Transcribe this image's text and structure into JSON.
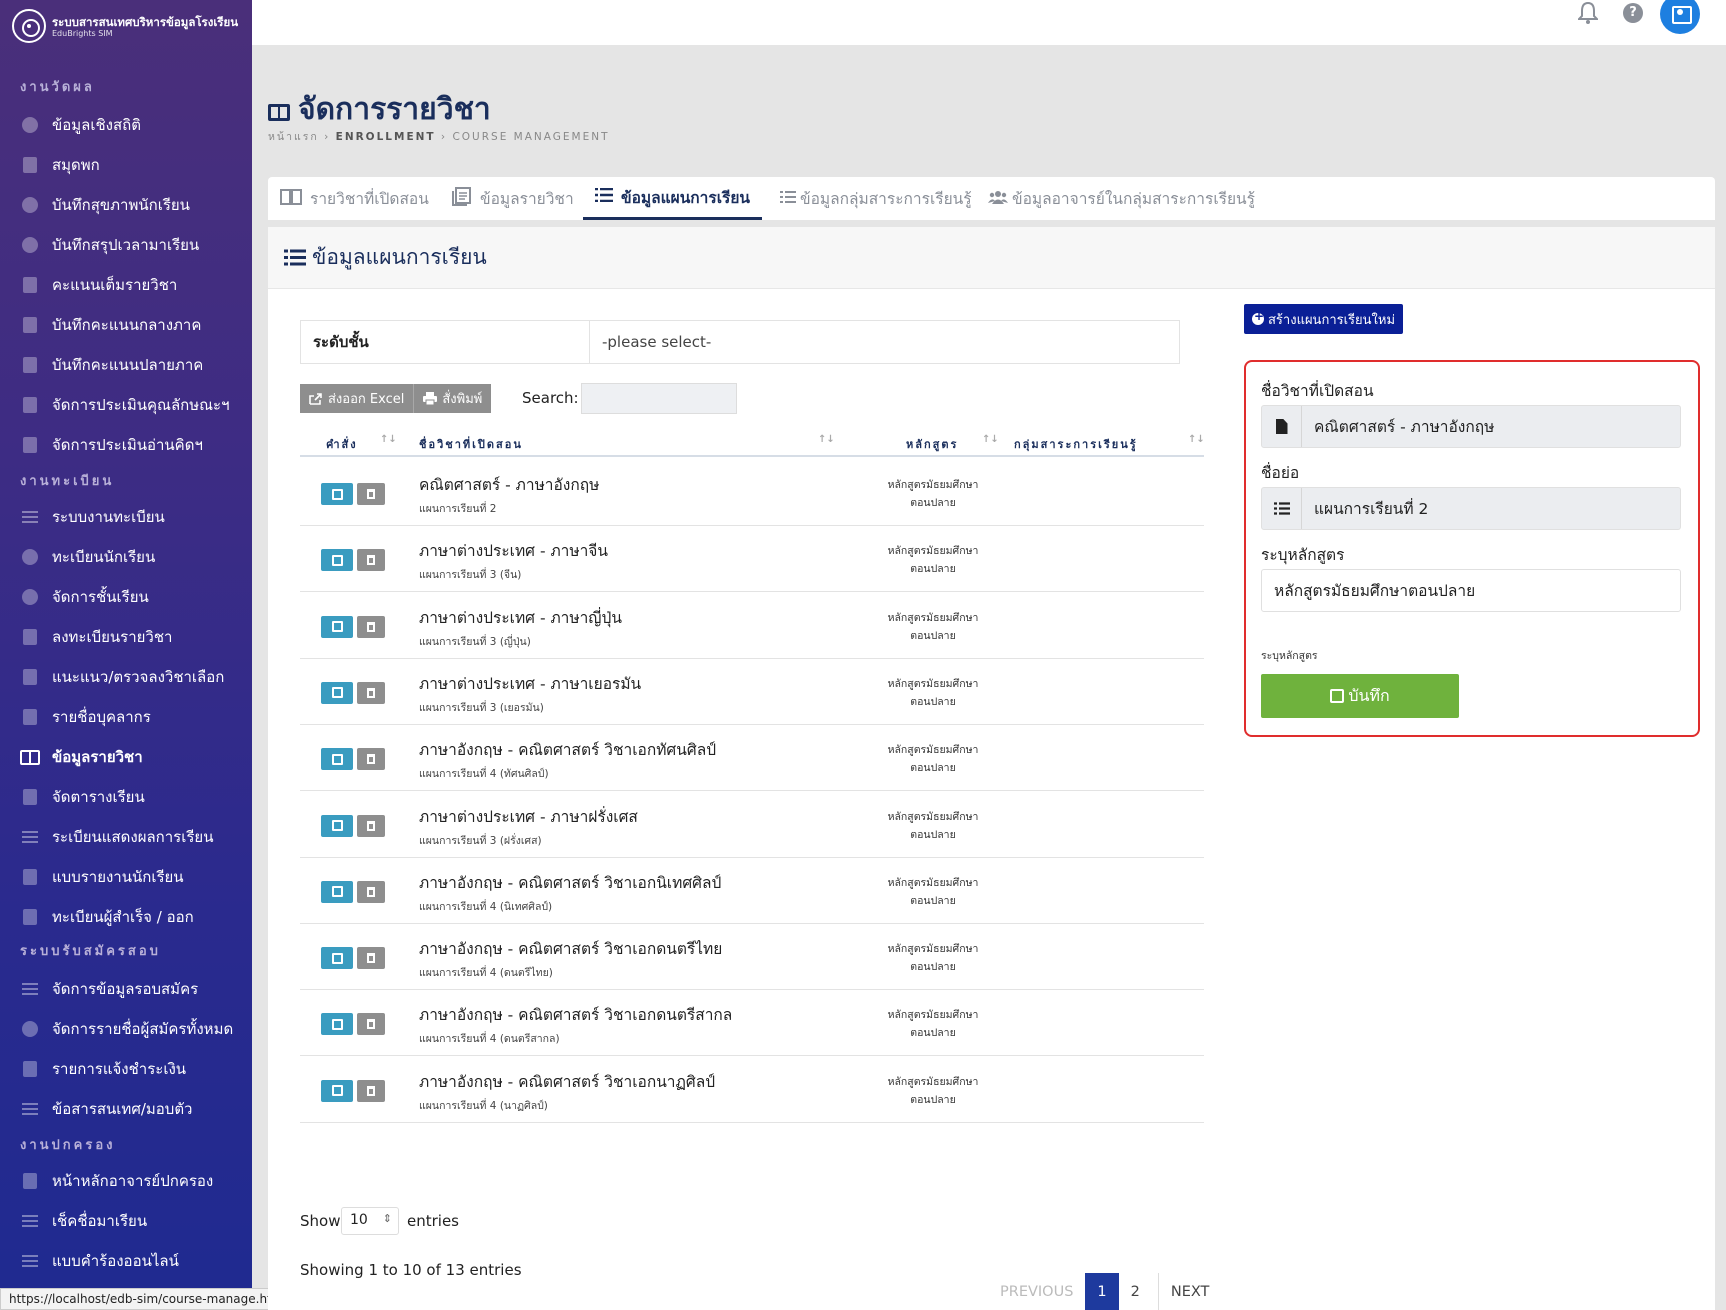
{
  "brand": {
    "title": "ระบบสารสนเทศบริหารข้อมูลโรงเรียน",
    "subtitle": "EduBrights SIM"
  },
  "sidebar": {
    "sections": [
      {
        "label": "งานวัดผล",
        "items": [
          {
            "label": "ข้อมูลเชิงสถิติ",
            "icon": "chart-pie-icon"
          },
          {
            "label": "สมุดพก",
            "icon": "book-icon"
          },
          {
            "label": "บันทึกสุขภาพนักเรียน",
            "icon": "shield-icon"
          },
          {
            "label": "บันทึกสรุปเวลามาเรียน",
            "icon": "shield-icon"
          },
          {
            "label": "คะแนนเต็มรายวิชา",
            "icon": "book-icon"
          },
          {
            "label": "บันทึกคะแนนกลางภาค",
            "icon": "book-icon"
          },
          {
            "label": "บันทึกคะแนนปลายภาค",
            "icon": "book-icon"
          },
          {
            "label": "จัดการประเมินคุณลักษณะฯ",
            "icon": "book-icon"
          },
          {
            "label": "จัดการประเมินอ่านคิดฯ",
            "icon": "book-icon"
          }
        ]
      },
      {
        "label": "งานทะเบียน",
        "items": [
          {
            "label": "ระบบงานทะเบียน",
            "icon": "list-icon"
          },
          {
            "label": "ทะเบียนนักเรียน",
            "icon": "smile-icon"
          },
          {
            "label": "จัดการชั้นเรียน",
            "icon": "user-circle-icon"
          },
          {
            "label": "ลงทะเบียนรายวิชา",
            "icon": "checklist-icon"
          },
          {
            "label": "แนะแนว/ตรวจลงวิชาเลือก",
            "icon": "plus-square-icon"
          },
          {
            "label": "รายชื่อบุคลากร",
            "icon": "id-badge-icon"
          },
          {
            "label": "ข้อมูลรายวิชา",
            "icon": "book-open-icon",
            "active": true
          },
          {
            "label": "จัดตารางเรียน",
            "icon": "calendar-icon"
          },
          {
            "label": "ระเบียนแสดงผลการเรียน",
            "icon": "align-icon"
          },
          {
            "label": "แบบรายงานนักเรียน",
            "icon": "print-icon"
          },
          {
            "label": "ทะเบียนผู้สำเร็จ / ออก",
            "icon": "graduation-cap-icon"
          }
        ]
      },
      {
        "label": "ระบบรับสมัครสอบ",
        "items": [
          {
            "label": "จัดการข้อมูลรอบสมัคร",
            "icon": "list-icon"
          },
          {
            "label": "จัดการรายชื่อผู้สมัครทั้งหมด",
            "icon": "user-icon"
          },
          {
            "label": "รายการแจ้งชำระเงิน",
            "icon": "payment-icon"
          },
          {
            "label": "ข้อสารสนเทศ/มอบตัว",
            "icon": "list-icon"
          }
        ]
      },
      {
        "label": "งานปกครอง",
        "items": [
          {
            "label": "หน้าหลักอาจารย์ปกครอง",
            "icon": "dashboard-icon"
          },
          {
            "label": "เช็คชื่อมาเรียน",
            "icon": "check-icon"
          },
          {
            "label": "แบบคำร้องออนไลน์",
            "icon": "form-icon"
          }
        ]
      }
    ]
  },
  "status_url": "https://localhost/edb-sim/course-manage.html#",
  "page": {
    "title": "จัดการรายวิชา",
    "breadcrumb": [
      "หน้าแรก",
      "ENROLLMENT",
      "COURSE MANAGEMENT"
    ]
  },
  "tabs": [
    {
      "label": "รายวิชาที่เปิดสอน",
      "icon": "book-open-icon",
      "active": false
    },
    {
      "label": "ข้อมูลรายวิชา",
      "icon": "clipboard-icon",
      "active": false
    },
    {
      "label": "ข้อมูลแผนการเรียน",
      "icon": "list-icon",
      "active": true
    },
    {
      "label": "ข้อมูลกลุ่มสาระการเรียนรู้",
      "icon": "list-icon",
      "active": false
    },
    {
      "label": "ข้อมูลอาจารย์ในกลุ่มสาระการเรียนรู้",
      "icon": "users-icon",
      "active": false
    }
  ],
  "card": {
    "title": "ข้อมูลแผนการเรียน"
  },
  "filter": {
    "label": "ระดับชั้น",
    "value": "-please select-"
  },
  "toolbar": {
    "excel": "ส่งออก Excel",
    "print": "สั่งพิมพ์",
    "search_label": "Search:"
  },
  "table": {
    "headers": [
      "คำสั่ง",
      "ชื่อวิชาที่เปิดสอน",
      "หลักสูตร",
      "กลุ่มสาระการเรียนรู้"
    ],
    "rows": [
      {
        "name": "คณิตศาสตร์ - ภาษาอังกฤษ",
        "plan": "แผนการเรียนที่ 2",
        "cur1": "หลักสูตรมัธยมศึกษา",
        "cur2": "ตอนปลาย"
      },
      {
        "name": "ภาษาต่างประเทศ - ภาษาจีน",
        "plan": "แผนการเรียนที่ 3 (จีน)",
        "cur1": "หลักสูตรมัธยมศึกษา",
        "cur2": "ตอนปลาย"
      },
      {
        "name": "ภาษาต่างประเทศ - ภาษาญี่ปุ่น",
        "plan": "แผนการเรียนที่ 3 (ญี่ปุ่น)",
        "cur1": "หลักสูตรมัธยมศึกษา",
        "cur2": "ตอนปลาย"
      },
      {
        "name": "ภาษาต่างประเทศ - ภาษาเยอรมัน",
        "plan": "แผนการเรียนที่ 3 (เยอรมัน)",
        "cur1": "หลักสูตรมัธยมศึกษา",
        "cur2": "ตอนปลาย"
      },
      {
        "name": "ภาษาอังกฤษ - คณิตศาสตร์ วิชาเอกทัศนศิลป์",
        "plan": "แผนการเรียนที่ 4 (ทัศนศิลป์)",
        "cur1": "หลักสูตรมัธยมศึกษา",
        "cur2": "ตอนปลาย"
      },
      {
        "name": "ภาษาต่างประเทศ - ภาษาฝรั่งเศส",
        "plan": "แผนการเรียนที่ 3 (ฝรั่งเศส)",
        "cur1": "หลักสูตรมัธยมศึกษา",
        "cur2": "ตอนปลาย"
      },
      {
        "name": "ภาษาอังกฤษ - คณิตศาสตร์ วิชาเอกนิเทศศิลป์",
        "plan": "แผนการเรียนที่ 4 (นิเทศศิลป์)",
        "cur1": "หลักสูตรมัธยมศึกษา",
        "cur2": "ตอนปลาย"
      },
      {
        "name": "ภาษาอังกฤษ - คณิตศาสตร์ วิชาเอกดนตรีไทย",
        "plan": "แผนการเรียนที่ 4 (ดนตรีไทย)",
        "cur1": "หลักสูตรมัธยมศึกษา",
        "cur2": "ตอนปลาย"
      },
      {
        "name": "ภาษาอังกฤษ - คณิตศาสตร์ วิชาเอกดนตรีสากล",
        "plan": "แผนการเรียนที่ 4 (ดนตรีสากล)",
        "cur1": "หลักสูตรมัธยมศึกษา",
        "cur2": "ตอนปลาย"
      },
      {
        "name": "ภาษาอังกฤษ - คณิตศาสตร์ วิชาเอกนาฏศิลป์",
        "plan": "แผนการเรียนที่ 4 (นาฏศิลป์)",
        "cur1": "หลักสูตรมัธยมศึกษา",
        "cur2": "ตอนปลาย"
      }
    ]
  },
  "footer": {
    "show": "Show",
    "entries_value": "10",
    "entries": "entries",
    "info": "Showing 1 to 10 of 13 entries"
  },
  "pagination": {
    "previous": "PREVIOUS",
    "pages": [
      "1",
      "2"
    ],
    "current": "1",
    "next": "NEXT"
  },
  "form": {
    "new_button": "สร้างแผนการเรียนใหม่",
    "course_label": "ชื่อวิชาที่เปิดสอน",
    "course_value": "คณิตศาสตร์ - ภาษาอังกฤษ",
    "short_label": "ชื่อย่อ",
    "short_value": "แผนการเรียนที่ 2",
    "curriculum_label": "ระบุหลักสูตร",
    "curriculum_value": "หลักสูตรมัธยมศึกษาตอนปลาย",
    "curriculum_help": "ระบุหลักสูตร",
    "save": "บันทึก"
  },
  "colors": {
    "sidebar_top": "#4a2f7a",
    "sidebar_bottom": "#1f2a90",
    "accent": "#1a2e5c",
    "save": "#6fb23d",
    "edit": "#3a9cc0",
    "panel_border": "#e02d2d",
    "new_button": "#0a1f96"
  }
}
